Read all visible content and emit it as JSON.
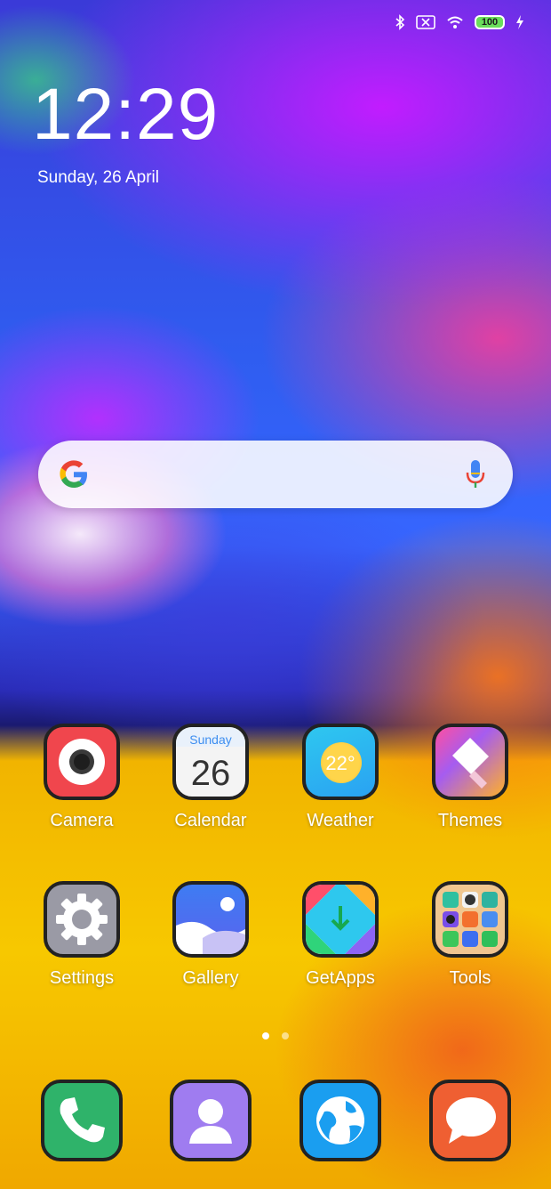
{
  "status_bar": {
    "battery_level": "100",
    "icons": [
      "bluetooth-icon",
      "no-sim-icon",
      "wifi-icon",
      "battery-icon",
      "charging-icon"
    ]
  },
  "lock_widget": {
    "time": "12:29",
    "date": "Sunday, 26 April"
  },
  "search_widget": {
    "icons": [
      "google-logo-icon",
      "microphone-icon"
    ]
  },
  "apps": [
    {
      "label": "Camera"
    },
    {
      "label": "Calendar",
      "day_name": "Sunday",
      "day_number": "26"
    },
    {
      "label": "Weather",
      "temperature": "22°"
    },
    {
      "label": "Themes"
    },
    {
      "label": "Settings"
    },
    {
      "label": "Gallery"
    },
    {
      "label": "GetApps"
    },
    {
      "label": "Tools"
    }
  ],
  "page_indicator": {
    "pages": 2,
    "current": 1
  },
  "dock": {
    "apps": [
      "phone-icon",
      "contacts-icon",
      "browser-icon",
      "messaging-icon"
    ]
  },
  "colors": {
    "camera_bg": "#f0464d",
    "weather_bg": "#23c0ee",
    "settings_bg": "#9a9aa5",
    "gallery_bg": "#4d6cf2",
    "phone_bg": "#2fb36a",
    "contacts_bg": "#9f7cf0",
    "browser_bg": "#1a9ef0",
    "messaging_bg": "#ef5f32"
  }
}
